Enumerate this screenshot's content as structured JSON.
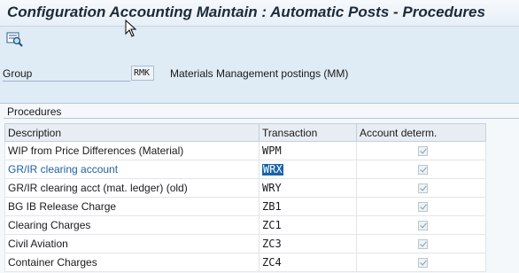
{
  "window": {
    "title": "Configuration Accounting Maintain : Automatic Posts - Procedures"
  },
  "toolbar": {
    "display_icon": "magnifier-icon"
  },
  "header": {
    "group_label": "Group",
    "group_value": "RMK",
    "group_description": "Materials Management postings (MM)"
  },
  "procedures": {
    "title": "Procedures",
    "columns": [
      "Description",
      "Transaction",
      "Account determ."
    ],
    "rows": [
      {
        "description": "WIP from Price Differences (Material)",
        "transaction": "WPM",
        "account_determination": true
      },
      {
        "description": "GR/IR clearing account",
        "transaction": "WRX",
        "account_determination": true
      },
      {
        "description": "GR/IR clearing acct (mat. ledger) (old)",
        "transaction": "WRY",
        "account_determination": true
      },
      {
        "description": "BG IB Release Charge",
        "transaction": "ZB1",
        "account_determination": true
      },
      {
        "description": "Clearing Charges",
        "transaction": "ZC1",
        "account_determination": true
      },
      {
        "description": "Civil Aviation",
        "transaction": "ZC3",
        "account_determination": true
      },
      {
        "description": "Container Charges",
        "transaction": "ZC4",
        "account_determination": true
      }
    ],
    "selected_row": 1
  },
  "colors": {
    "selected_text": "#1d5f9e",
    "selection_fill": "#1a64a8",
    "focus_frame": "#e03a2f",
    "background": "#dfebf5"
  }
}
